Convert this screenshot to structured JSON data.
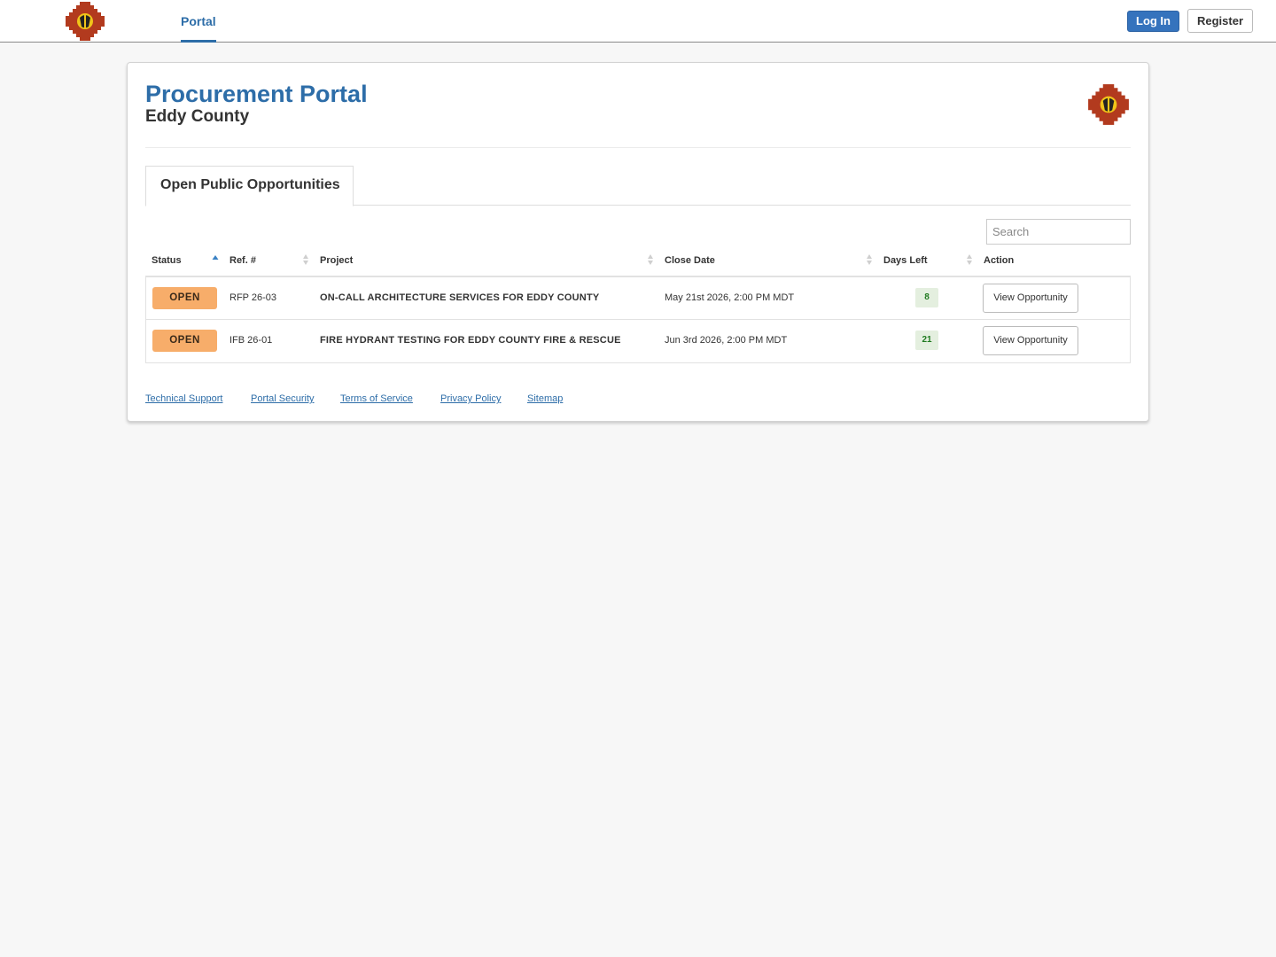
{
  "header": {
    "nav_portal": "Portal",
    "login_label": "Log In",
    "register_label": "Register"
  },
  "page": {
    "title": "Procurement Portal",
    "subtitle": "Eddy County"
  },
  "tab": {
    "label": "Open Public Opportunities"
  },
  "search": {
    "placeholder": "Search"
  },
  "table": {
    "columns": [
      "Status",
      "Ref. #",
      "Project",
      "Close Date",
      "Days Left",
      "Action"
    ],
    "rows": [
      {
        "status": "OPEN",
        "ref": "RFP 26-03",
        "project": "ON-CALL ARCHITECTURE SERVICES FOR EDDY COUNTY",
        "close_date": "May 21st 2026, 2:00 PM MDT",
        "days_left": "8",
        "action": "View Opportunity"
      },
      {
        "status": "OPEN",
        "ref": "IFB 26-01",
        "project": "FIRE HYDRANT TESTING FOR EDDY COUNTY FIRE & RESCUE",
        "close_date": "Jun 3rd 2026, 2:00 PM MDT",
        "days_left": "21",
        "action": "View Opportunity"
      }
    ]
  },
  "footer": {
    "links": [
      "Technical Support",
      "Portal Security",
      "Terms of Service",
      "Privacy Policy",
      "Sitemap"
    ]
  },
  "colors": {
    "brand_blue": "#2d6da8",
    "login_blue": "#3573bd",
    "open_badge": "#f7ad6a",
    "days_badge_bg": "#e4efdf",
    "days_badge_text": "#1f7a1f",
    "seal_red": "#b23a1e",
    "seal_yellow": "#f0c419"
  },
  "icons": {
    "header_logo": "county-seal-icon",
    "card_logo": "county-seal-icon",
    "sort_asc": "sort-ascending-icon",
    "sort_both": "sort-icon"
  }
}
